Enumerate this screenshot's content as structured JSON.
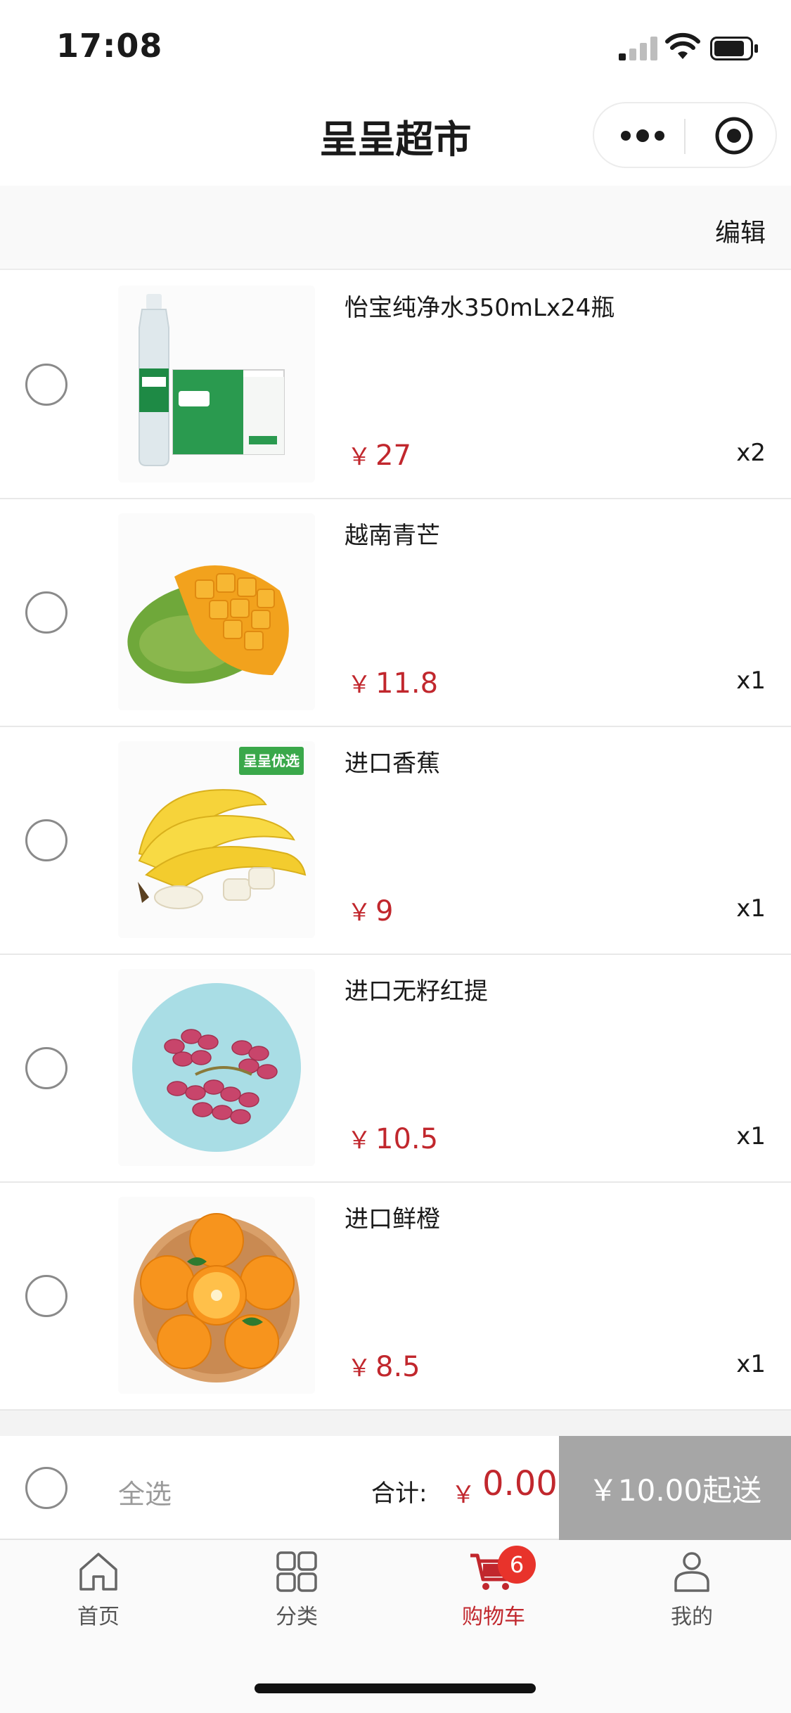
{
  "status_bar": {
    "time": "17:08"
  },
  "nav": {
    "title": "呈呈超市"
  },
  "toolbar": {
    "edit_label": "编辑"
  },
  "cart": {
    "items": [
      {
        "name": "怡宝纯净水350mLx24瓶",
        "currency": "￥",
        "price": "27",
        "qty": "x2",
        "image": "water-bottle-case"
      },
      {
        "name": "越南青芒",
        "currency": "￥",
        "price": "11.8",
        "qty": "x1",
        "image": "mango"
      },
      {
        "name": "进口香蕉",
        "currency": "￥",
        "price": "9",
        "qty": "x1",
        "image": "banana",
        "tag": "呈呈优选"
      },
      {
        "name": "进口无籽红提",
        "currency": "￥",
        "price": "10.5",
        "qty": "x1",
        "image": "red-grapes"
      },
      {
        "name": "进口鲜橙",
        "currency": "￥",
        "price": "8.5",
        "qty": "x1",
        "image": "oranges"
      }
    ]
  },
  "summary": {
    "select_all_label": "全选",
    "total_label": "合计:",
    "total_currency": "￥",
    "total_amount": "0.00",
    "checkout_label": "￥10.00起送"
  },
  "tabs": [
    {
      "label": "首页",
      "icon": "home-icon"
    },
    {
      "label": "分类",
      "icon": "category-icon"
    },
    {
      "label": "购物车",
      "icon": "cart-icon",
      "badge": "6",
      "active": true
    },
    {
      "label": "我的",
      "icon": "profile-icon"
    }
  ],
  "colors": {
    "accent": "#c1272d",
    "badge": "#e8332b",
    "disabled_button": "#a6a6a6"
  }
}
